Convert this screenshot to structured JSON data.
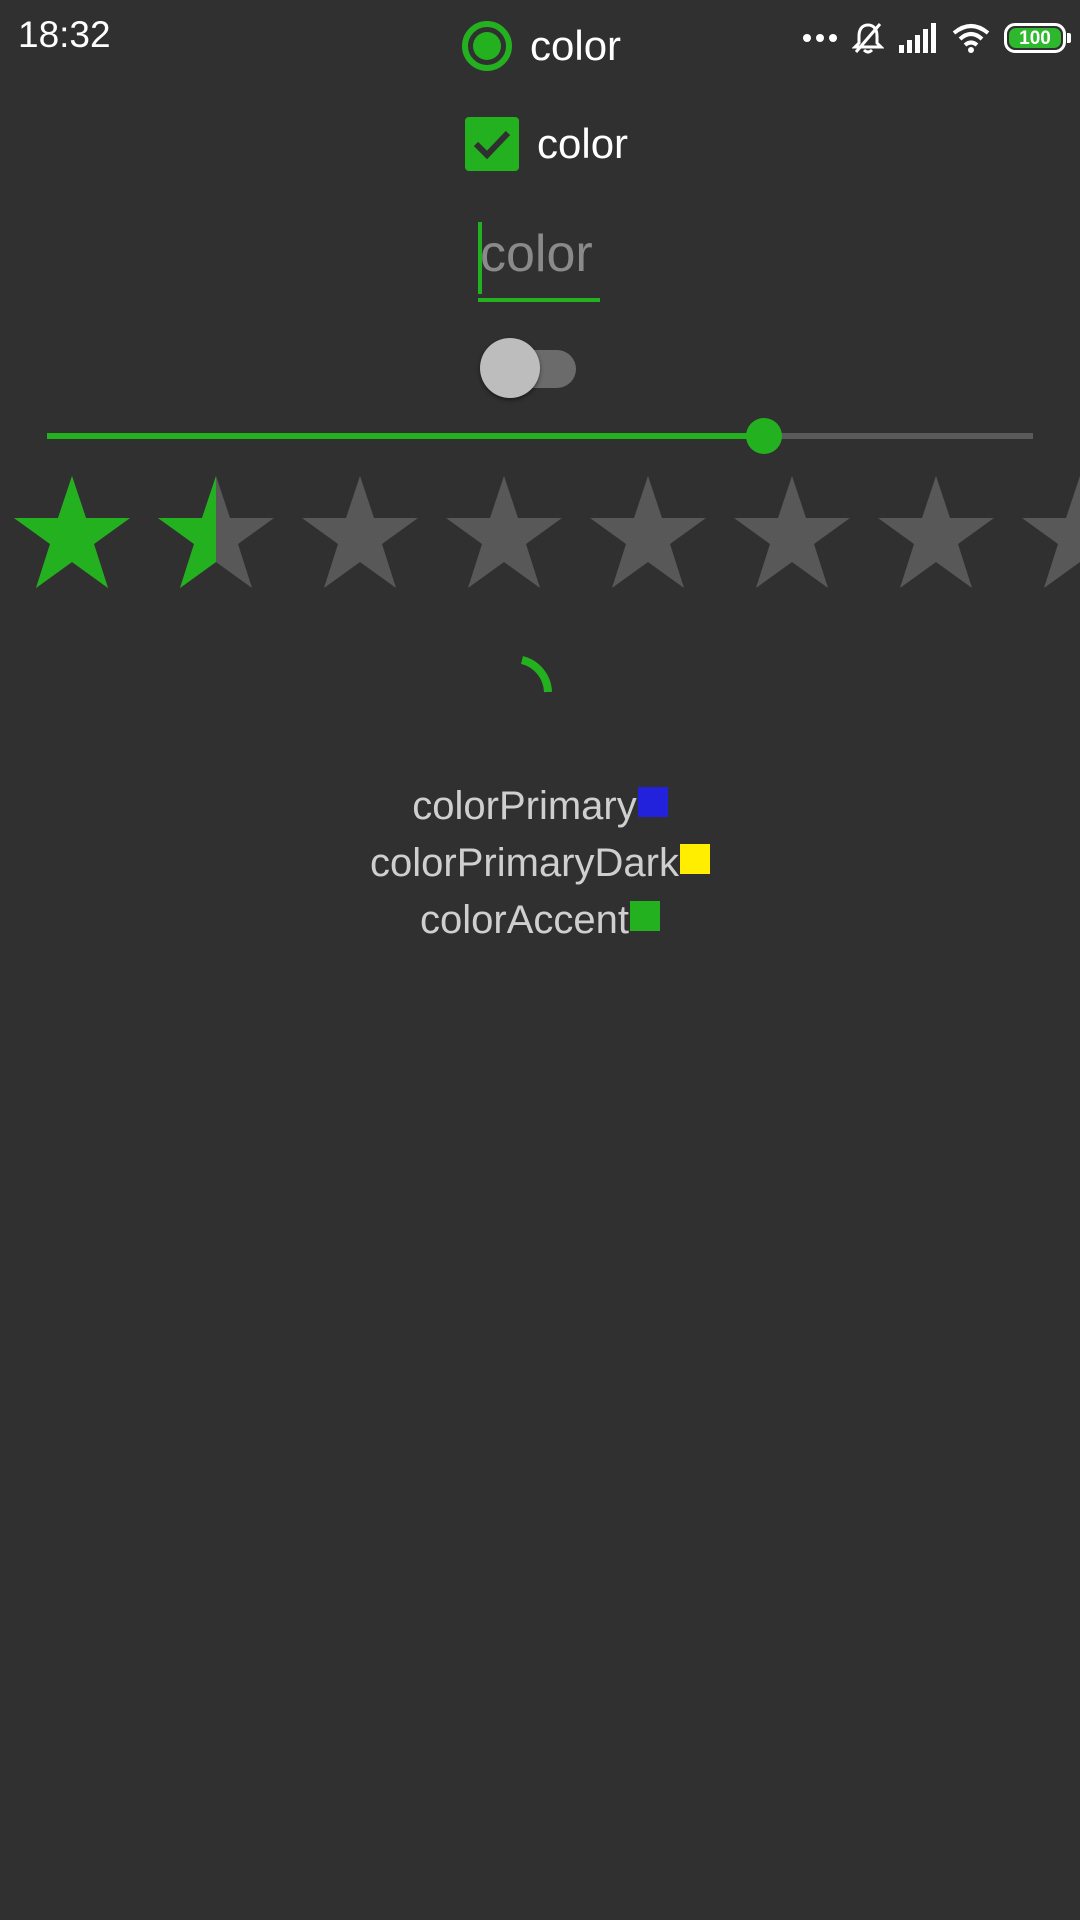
{
  "status_bar": {
    "time": "18:32",
    "icons": [
      "more-dots-icon",
      "bell-off-icon",
      "signal-icon",
      "wifi-icon",
      "battery-icon"
    ],
    "battery_level": "100"
  },
  "radio": {
    "label": "color",
    "checked": true
  },
  "checkbox": {
    "label": "color",
    "checked": true
  },
  "edit_text": {
    "placeholder": "color",
    "value": ""
  },
  "switch": {
    "on": false
  },
  "seekbar": {
    "progress_fraction": 0.727
  },
  "rating_bar": {
    "rating": 1.5,
    "visible_stars": 8
  },
  "progress_indicator": {
    "type": "indeterminate-circular"
  },
  "colors": {
    "accent": "#24b11f",
    "background": "#303030",
    "items": [
      {
        "name": "colorPrimary",
        "hex": "#2222dd"
      },
      {
        "name": "colorPrimaryDark",
        "hex": "#ffee00"
      },
      {
        "name": "colorAccent",
        "hex": "#24b11f"
      }
    ]
  }
}
